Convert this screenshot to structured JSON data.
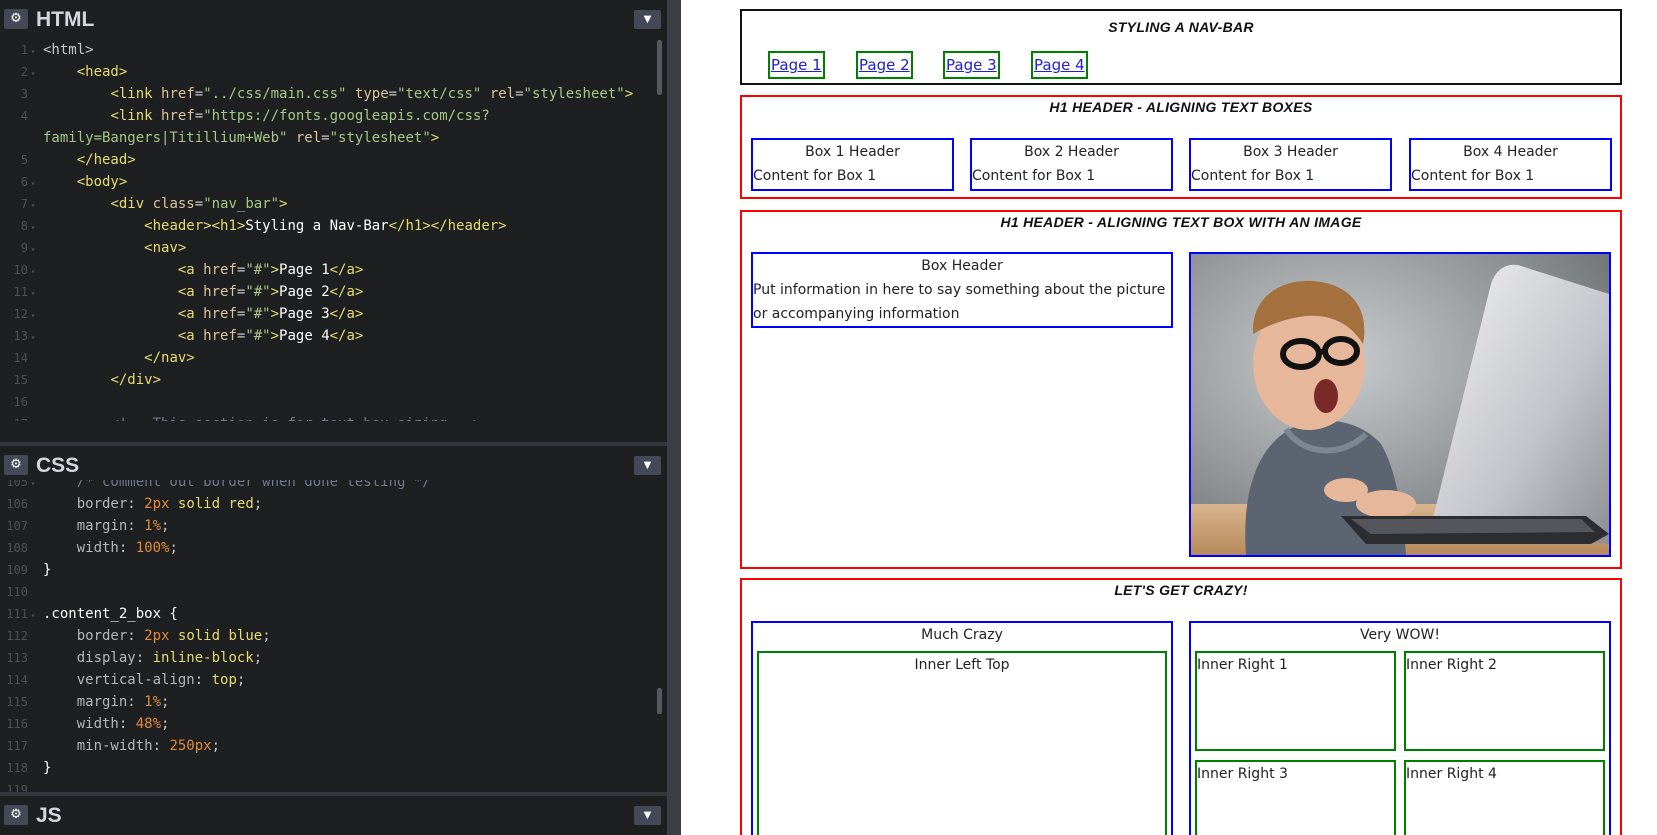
{
  "editor": {
    "html_pane": {
      "title": "HTML",
      "lines": [
        {
          "n": "1",
          "fold": "▾",
          "html": "<span style='color:#c5c8c6'>&lt;html&gt;</span>"
        },
        {
          "n": "2",
          "fold": "▾",
          "html": "    <span style='color:#e6db74'>&lt;head&gt;</span>"
        },
        {
          "n": "3",
          "fold": "",
          "html": "        <span style='color:#e6db74'>&lt;link</span> <span style='color:#dcc39a'>href</span>=<span style='color:#a6c787'>\"../css/main.css\"</span> <span style='color:#dcc39a'>type</span>=<span style='color:#a6c787'>\"text/css\"</span> <span style='color:#dcc39a'>rel</span>=<span style='color:#a6c787'>\"stylesheet\"</span><span style='color:#e6db74'>&gt;</span>"
        },
        {
          "n": "4",
          "fold": "",
          "html": "        <span style='color:#e6db74'>&lt;link</span> <span style='color:#dcc39a'>href</span>=<span style='color:#a6c787'>\"https://fonts.googleapis.com/css?</span>"
        },
        {
          "n": "",
          "fold": "",
          "html": "<span style='color:#a6c787'>family=Bangers|Titillium+Web\"</span> <span style='color:#dcc39a'>rel</span>=<span style='color:#a6c787'>\"stylesheet\"</span><span style='color:#e6db74'>&gt;</span>"
        },
        {
          "n": "5",
          "fold": "",
          "html": "    <span style='color:#e6db74'>&lt;/head&gt;</span>"
        },
        {
          "n": "6",
          "fold": "▾",
          "html": "    <span style='color:#e6db74'>&lt;body&gt;</span>"
        },
        {
          "n": "7",
          "fold": "▾",
          "html": "        <span style='color:#e6db74'>&lt;div</span> <span style='color:#dcc39a'>class</span>=<span style='color:#a6c787'>\"nav_bar\"</span><span style='color:#e6db74'>&gt;</span>"
        },
        {
          "n": "8",
          "fold": "▾",
          "html": "            <span style='color:#e6db74'>&lt;header&gt;&lt;h1&gt;</span><span style='color:#fff'>Styling a Nav-Bar</span><span style='color:#e6db74'>&lt;/h1&gt;&lt;/header&gt;</span>"
        },
        {
          "n": "9",
          "fold": "▾",
          "html": "            <span style='color:#e6db74'>&lt;nav&gt;</span>"
        },
        {
          "n": "10",
          "fold": "▾",
          "html": "                <span style='color:#e6db74'>&lt;a</span> <span style='color:#dcc39a'>href</span>=<span style='color:#a6c787'>\"#\"</span><span style='color:#e6db74'>&gt;</span><span style='color:#fff'>Page 1</span><span style='color:#e6db74'>&lt;/a&gt;</span>"
        },
        {
          "n": "11",
          "fold": "▾",
          "html": "                <span style='color:#e6db74'>&lt;a</span> <span style='color:#dcc39a'>href</span>=<span style='color:#a6c787'>\"#\"</span><span style='color:#e6db74'>&gt;</span><span style='color:#fff'>Page 2</span><span style='color:#e6db74'>&lt;/a&gt;</span>"
        },
        {
          "n": "12",
          "fold": "▾",
          "html": "                <span style='color:#e6db74'>&lt;a</span> <span style='color:#dcc39a'>href</span>=<span style='color:#a6c787'>\"#\"</span><span style='color:#e6db74'>&gt;</span><span style='color:#fff'>Page 3</span><span style='color:#e6db74'>&lt;/a&gt;</span>"
        },
        {
          "n": "13",
          "fold": "▾",
          "html": "                <span style='color:#e6db74'>&lt;a</span> <span style='color:#dcc39a'>href</span>=<span style='color:#a6c787'>\"#\"</span><span style='color:#e6db74'>&gt;</span><span style='color:#fff'>Page 4</span><span style='color:#e6db74'>&lt;/a&gt;</span>"
        },
        {
          "n": "14",
          "fold": "",
          "html": "            <span style='color:#e6db74'>&lt;/nav&gt;</span>"
        },
        {
          "n": "15",
          "fold": "",
          "html": "        <span style='color:#e6db74'>&lt;/div&gt;</span>"
        },
        {
          "n": "16",
          "fold": "",
          "html": ""
        },
        {
          "n": "17",
          "fold": "▾",
          "html": "        <span style='color:#717790'>&lt;!-- This section is for text box sizing --&gt;</span>"
        }
      ]
    },
    "css_pane": {
      "title": "CSS",
      "lines": [
        {
          "n": "105",
          "fold": "▾",
          "html": "    <span style='color:#717790'>/* comment out border when done testing */</span>"
        },
        {
          "n": "106",
          "fold": "",
          "html": "    <span style='color:#b4b7b4'>border</span>: <span style='color:#e08a3c'>2px</span> <span style='color:#e6db74'>solid red</span>;"
        },
        {
          "n": "107",
          "fold": "",
          "html": "    <span style='color:#b4b7b4'>margin</span>: <span style='color:#e08a3c'>1%</span>;"
        },
        {
          "n": "108",
          "fold": "",
          "html": "    <span style='color:#b4b7b4'>width</span>: <span style='color:#e08a3c'>100%</span>;"
        },
        {
          "n": "109",
          "fold": "",
          "html": "<span style='color:#fff'>}</span>"
        },
        {
          "n": "110",
          "fold": "",
          "html": ""
        },
        {
          "n": "111",
          "fold": "▾",
          "html": "<span style='color:#fff'>.content_2_box {</span>"
        },
        {
          "n": "112",
          "fold": "",
          "html": "    <span style='color:#b4b7b4'>border</span>: <span style='color:#e08a3c'>2px</span> <span style='color:#e6db74'>solid blue</span>;"
        },
        {
          "n": "113",
          "fold": "",
          "html": "    <span style='color:#b4b7b4'>display</span>: <span style='color:#e6db74'>inline-block</span>;"
        },
        {
          "n": "114",
          "fold": "",
          "html": "    <span style='color:#b4b7b4'>vertical-align</span>: <span style='color:#e6db74'>top</span>;"
        },
        {
          "n": "115",
          "fold": "",
          "html": "    <span style='color:#b4b7b4'>margin</span>: <span style='color:#e08a3c'>1%</span>;"
        },
        {
          "n": "116",
          "fold": "",
          "html": "    <span style='color:#b4b7b4'>width</span>: <span style='color:#e08a3c'>48%</span>;"
        },
        {
          "n": "117",
          "fold": "",
          "html": "    <span style='color:#b4b7b4'>min-width</span>: <span style='color:#e08a3c'>250px</span>;"
        },
        {
          "n": "118",
          "fold": "",
          "html": "<span style='color:#fff'>}</span>"
        },
        {
          "n": "119",
          "fold": "",
          "html": ""
        }
      ]
    },
    "js_pane": {
      "title": "JS"
    }
  },
  "preview": {
    "navbar": {
      "title": "Styling a Nav-Bar",
      "links": [
        "Page 1",
        "Page 2",
        "Page 3",
        "Page 4"
      ]
    },
    "section1": {
      "title": "H1 Header - Aligning Text Boxes",
      "boxes": [
        {
          "header": "Box 1 Header",
          "content": "Content for Box 1"
        },
        {
          "header": "Box 2 Header",
          "content": "Content for Box 1"
        },
        {
          "header": "Box 3 Header",
          "content": "Content for Box 1"
        },
        {
          "header": "Box 4 Header",
          "content": "Content for Box 1"
        }
      ]
    },
    "section2": {
      "title": "H1 Header - Aligning Text Box with an Image",
      "box_header": "Box Header",
      "box_text": "Put information in here to say something about the picture or accompanying information"
    },
    "section3": {
      "title": "Let's Get Crazy!",
      "left_header": "Much Crazy",
      "left_inner": "Inner Left Top",
      "right_header": "Very WOW!",
      "right_inner": [
        "Inner Right 1",
        "Inner Right 2",
        "Inner Right 3",
        "Inner Right 4"
      ]
    },
    "colors": {
      "nav_border": "#111111",
      "section_border": "#ff0000",
      "box_border": "#0000ff",
      "inner_border": "#008000",
      "link": "#2020d0"
    }
  }
}
